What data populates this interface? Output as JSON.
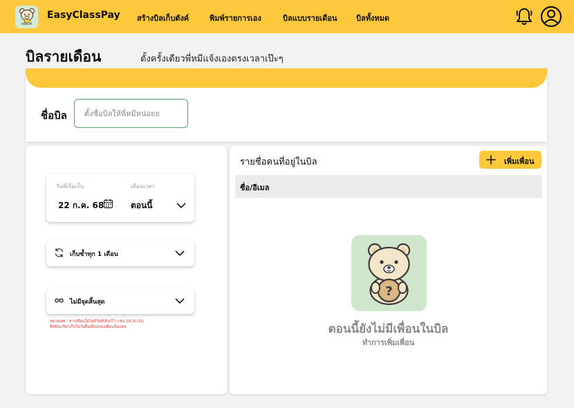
{
  "app": {
    "name": "EasyClassPay",
    "logo_text": "หมีตังค์"
  },
  "nav": {
    "items": [
      {
        "label": "สร้างบิลเก็บตังค์"
      },
      {
        "label": "พิมพ์รายการเอง"
      },
      {
        "label": "บิลแบบรายเดือน"
      },
      {
        "label": "บิลทั้งหมด"
      }
    ],
    "icons": [
      "bell-icon",
      "user-icon"
    ]
  },
  "page": {
    "title": "บิลรายเดือน",
    "subtitle": "ตั้งครั้งเดียวพี่หมีแจ้งเองตรงเวลาเป๊ะๆ"
  },
  "bill_name": {
    "label": "ชื่อบิล",
    "placeholder": "ตั้งชื่อบิลให้พี่หมีหน่อยย",
    "value": ""
  },
  "schedule": {
    "start_label": "วันที่เริ่มเก็บ",
    "start_value": "22 ก.ค. 68",
    "time_label": "เดือนเวลา",
    "time_value": "ตอนนี้",
    "repeat_label": "เก็บซ้ำทุก 1 เดือน",
    "end_label": "ไม่มีจุดสิ้นสุด",
    "note_line1": "หมายเหตุ : หากเดือนใดไม่มีวันที่เลือกไว้ (เช่น 29,30,31)",
    "note_line2": "พี่หมีจะเรียกเก็บในวันสิ้นเดือนของเดือนนั้นแทน"
  },
  "members": {
    "title": "รายชื่อคนที่อยู่ในบิล",
    "add_button": "เพิ่มเพื่อน",
    "column_header": "ชื่อ/อีเมล",
    "empty_title": "ตอนนี้ยังไม่มีเพื่อนในบิล",
    "empty_subtitle": "ทำการเพิ่มเพื่อน"
  },
  "colors": {
    "accent": "#fdc93a",
    "mint": "#cfe6cc",
    "input_border": "#55a26a",
    "note_red": "#d9342b"
  }
}
